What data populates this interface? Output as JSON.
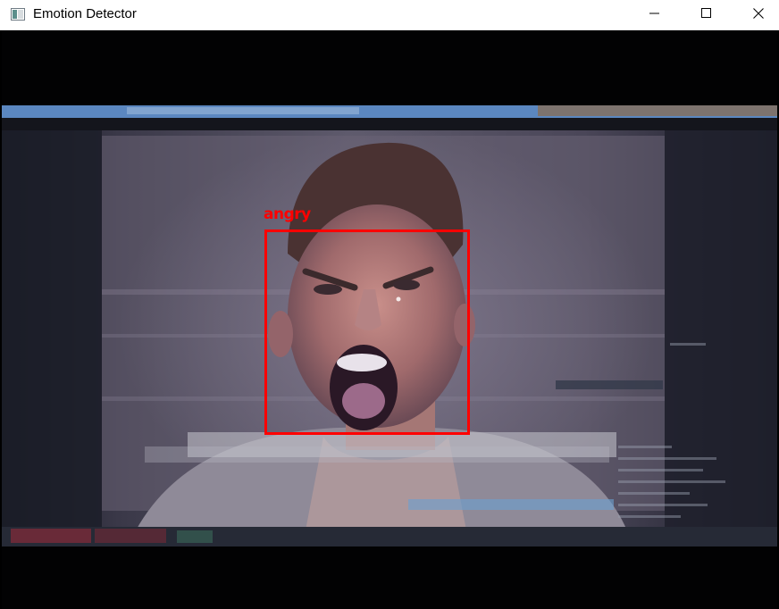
{
  "window": {
    "title": "Emotion Detector",
    "icon": "opencv-window-icon",
    "controls": {
      "minimize_icon": "minimize-icon",
      "maximize_icon": "maximize-icon",
      "close_icon": "close-icon"
    }
  },
  "detection": {
    "label": "angry",
    "color": "#ff0000"
  },
  "colors": {
    "titlebar_bg": "#ffffff",
    "frame_bg": "#000000",
    "box": "#ff0000"
  }
}
